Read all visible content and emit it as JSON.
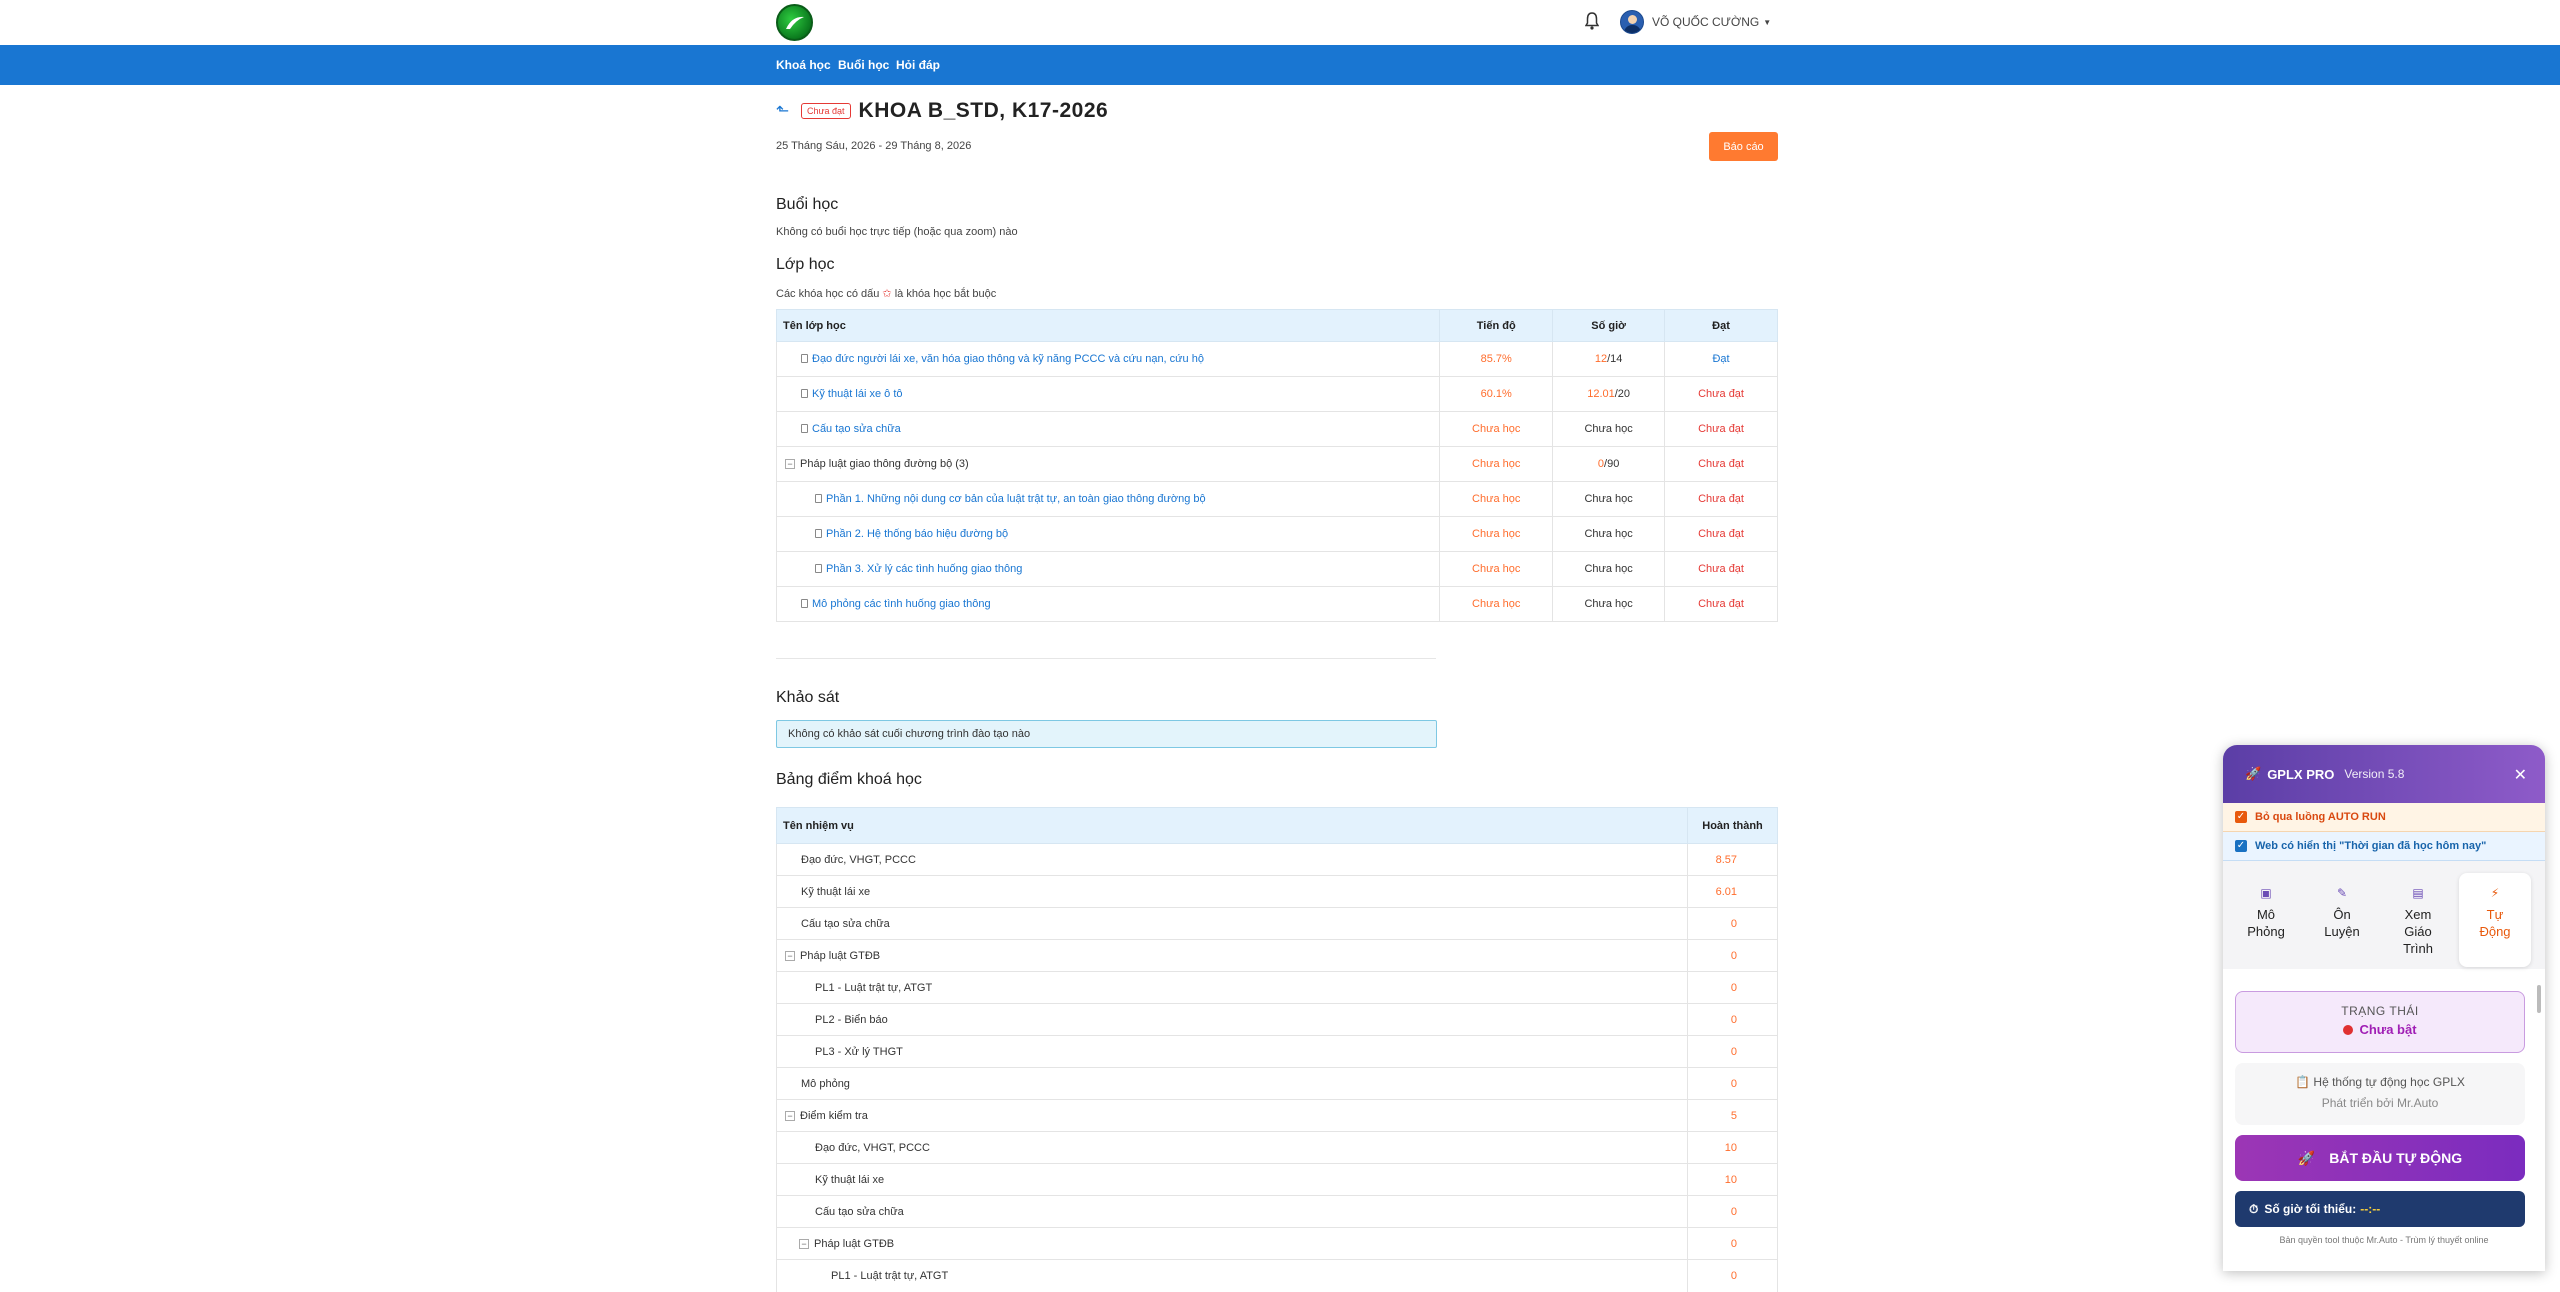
{
  "header": {
    "user_name": "VÕ QUỐC CƯỜNG",
    "nav": [
      "Khoá học",
      "Buổi học",
      "Hỏi đáp"
    ]
  },
  "course": {
    "status_badge": "Chưa đạt",
    "title": "KHOA B_STD, K17-2026",
    "dates": "25 Tháng Sáu, 2026 - 29 Tháng 8, 2026",
    "report_button": "Báo cáo"
  },
  "sessions": {
    "heading": "Buổi học",
    "note": "Không có buổi học trực tiếp (hoặc qua zoom) nào"
  },
  "classes": {
    "heading": "Lớp học",
    "note_before": "Các khóa học có dấu",
    "note_star": "✩",
    "note_after": "là khóa học bắt buộc",
    "columns": [
      "Tên lớp học",
      "Tiến độ",
      "Số giờ",
      "Đạt"
    ],
    "rows": [
      {
        "name": "Đạo đức người lái xe, văn hóa giao thông và kỹ năng PCCC và cứu nạn, cứu hộ",
        "progress": "85.7%",
        "hours_done": "12",
        "hours_total": "/14",
        "hours_text": "",
        "result": "Đạt"
      },
      {
        "name": "Kỹ thuật lái xe ô tô",
        "progress": "60.1%",
        "hours_done": "12.01",
        "hours_total": "/20",
        "hours_text": "",
        "result": "Chưa đạt"
      },
      {
        "name": "Cấu tạo sửa chữa",
        "progress": "Chưa học",
        "hours_done": "",
        "hours_total": "",
        "hours_text": "Chưa học",
        "result": "Chưa đạt"
      },
      {
        "name": "Pháp luật giao thông đường bộ",
        "count": "(3)",
        "progress": "Chưa học",
        "hours_done": "0",
        "hours_total": "/90",
        "hours_text": "",
        "result": "Chưa đạt"
      },
      {
        "name": "Phần 1. Những nội dung cơ bản của luật trật tự, an toàn giao thông đường bộ",
        "progress": "Chưa học",
        "hours_done": "",
        "hours_total": "",
        "hours_text": "Chưa học",
        "result": "Chưa đạt"
      },
      {
        "name": "Phần 2. Hệ thống báo hiệu đường bộ",
        "progress": "Chưa học",
        "hours_done": "",
        "hours_total": "",
        "hours_text": "Chưa học",
        "result": "Chưa đạt"
      },
      {
        "name": "Phần 3. Xử lý các tình huống giao thông",
        "progress": "Chưa học",
        "hours_done": "",
        "hours_total": "",
        "hours_text": "Chưa học",
        "result": "Chưa đạt"
      },
      {
        "name": "Mô phỏng các tình huống giao thông",
        "progress": "Chưa học",
        "hours_done": "",
        "hours_total": "",
        "hours_text": "Chưa học",
        "result": "Chưa đạt"
      }
    ]
  },
  "survey": {
    "heading": "Khảo sát",
    "note": "Không có khảo sát cuối chương trình đào tạo nào"
  },
  "grades": {
    "heading": "Bảng điểm khoá học",
    "columns": [
      "Tên nhiệm vụ",
      "Hoàn thành"
    ],
    "rows": [
      {
        "name": "Đạo đức, VHGT, PCCC",
        "value": "8.57"
      },
      {
        "name": "Kỹ thuật lái xe",
        "value": "6.01"
      },
      {
        "name": "Cấu tạo sửa chữa",
        "value": "0"
      },
      {
        "name": "Pháp luật GTĐB",
        "value": "0"
      },
      {
        "name": "PL1 - Luật trật tự, ATGT",
        "value": "0"
      },
      {
        "name": "PL2 - Biển báo",
        "value": "0"
      },
      {
        "name": "PL3 - Xử lý THGT",
        "value": "0"
      },
      {
        "name": "Mô phỏng",
        "value": "0"
      },
      {
        "name": "Điểm kiểm tra",
        "value": "5"
      },
      {
        "name": "Đạo đức, VHGT, PCCC",
        "value": "10"
      },
      {
        "name": "Kỹ thuật lái xe",
        "value": "10"
      },
      {
        "name": "Cấu tạo sửa chữa",
        "value": "0"
      },
      {
        "name": "Pháp luật GTĐB",
        "value": "0"
      },
      {
        "name": "PL1 - Luật trật tự, ATGT",
        "value": "0"
      }
    ]
  },
  "widget": {
    "brand": "GPLX PRO",
    "version": "Version 5.8",
    "check_auto_run": "Bỏ qua luồng AUTO RUN",
    "check_web_time": "Web có hiển thị \"Thời gian đã học hôm nay\"",
    "tabs": [
      {
        "line1": "Mô",
        "line2": "Phỏng",
        "line3": ""
      },
      {
        "line1": "Ôn",
        "line2": "Luyện",
        "line3": ""
      },
      {
        "line1": "Xem",
        "line2": "Giáo",
        "line3": "Trình"
      },
      {
        "line1": "Tự",
        "line2": "Động",
        "line3": ""
      }
    ],
    "status_label": "TRẠNG THÁI",
    "status_value": "Chưa bật",
    "info_title": "Hệ thống tự động học GPLX",
    "info_sub": "Phát triển bởi Mr.Auto",
    "start_button": "BẮT ĐẦU TỰ ĐỘNG",
    "min_hours_label": "Số giờ tối thiểu:",
    "min_hours_value": "--:--",
    "footer": "Bản quyền tool thuộc Mr.Auto - Trùm lý thuyết online"
  }
}
